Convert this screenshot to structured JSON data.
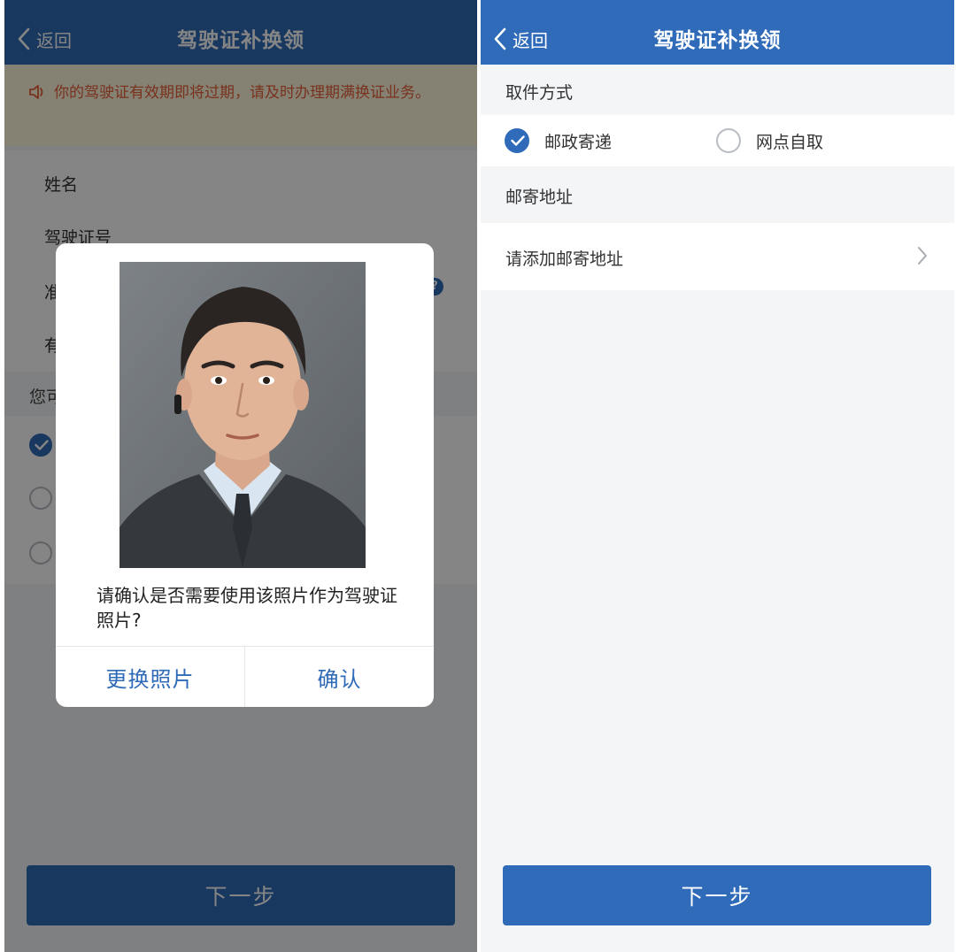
{
  "colors": {
    "primary": "#2f6bb8",
    "notice_text": "#e8613a",
    "overlay": "rgba(0,0,0,0.48)"
  },
  "left": {
    "nav": {
      "back_label": "返回",
      "title": "驾驶证补换领",
      "back_icon": "chevron-left-icon"
    },
    "notice": {
      "icon": "speaker-icon",
      "text": "你的驾驶证有效期即将过期，请及时办理期满换证业务。"
    },
    "form": {
      "name_label": "姓名",
      "license_label": "驾驶证号",
      "row3_partial": "准",
      "row4_partial": "有",
      "help_icon": "?"
    },
    "section_partial": "您可",
    "next_button": "下一步",
    "dialog": {
      "photo": "portrait-photo",
      "message": "请确认是否需要使用该照片作为驾驶证照片?",
      "change_button": "更换照片",
      "confirm_button": "确认"
    }
  },
  "right": {
    "nav": {
      "back_label": "返回",
      "title": "驾驶证补换领",
      "back_icon": "chevron-left-icon"
    },
    "pickup": {
      "title": "取件方式",
      "options": [
        {
          "label": "邮政寄递",
          "selected": true
        },
        {
          "label": "网点自取",
          "selected": false
        }
      ]
    },
    "mail": {
      "title": "邮寄地址",
      "placeholder": "请添加邮寄地址",
      "icon": "chevron-right-icon"
    },
    "next_button": "下一步"
  }
}
